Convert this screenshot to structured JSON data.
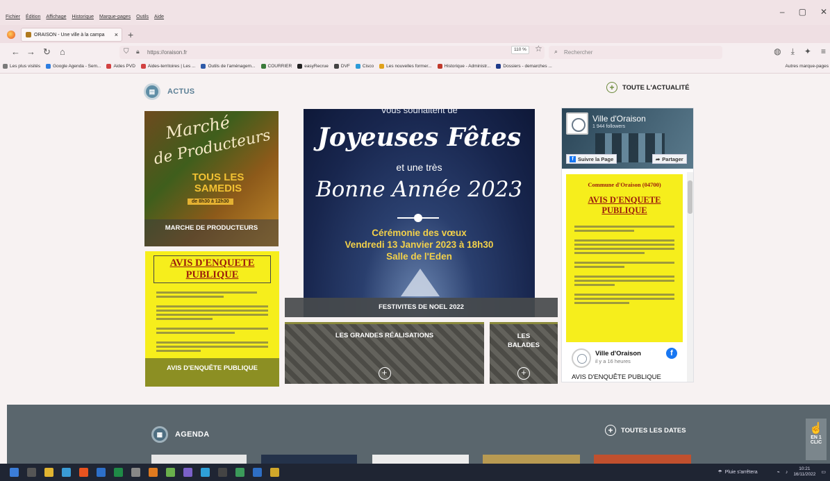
{
  "browser": {
    "menus": [
      "Fichier",
      "Édition",
      "Affichage",
      "Historique",
      "Marque-pages",
      "Outils",
      "Aide"
    ],
    "tab_title": "ORAISON - Une ville à la campa",
    "tab_close": "×",
    "new_tab": "+",
    "url": "https://oraison.fr",
    "zoom": "110 %",
    "search_placeholder": "Rechercher",
    "bookmarks": [
      {
        "label": "Les plus visités",
        "color": "#7a7a7a"
      },
      {
        "label": "Google Agenda - Sem...",
        "color": "#2d7de0"
      },
      {
        "label": "Aides PVD",
        "color": "#d24141"
      },
      {
        "label": "Aides-territoires | Les ...",
        "color": "#d24141"
      },
      {
        "label": "Outils de l'aménagem...",
        "color": "#2e5aa8"
      },
      {
        "label": "COURRIER",
        "color": "#3b7a3a"
      },
      {
        "label": "easyRecrue",
        "color": "#222"
      },
      {
        "label": "DVF",
        "color": "#444"
      },
      {
        "label": "Cisco",
        "color": "#2d9bd8"
      },
      {
        "label": "Les nouvelles former...",
        "color": "#e0a21b"
      },
      {
        "label": "Historique - Administr...",
        "color": "#c0392b"
      },
      {
        "label": "Dossiers - demarches ...",
        "color": "#1e3a8a"
      }
    ],
    "bookmarks_other": "Autres marque-pages"
  },
  "page": {
    "actus": {
      "title": "ACTUS",
      "more": "TOUTE L'ACTUALITÉ"
    },
    "cards": {
      "marche": {
        "script1": "Marché",
        "script2": "de Producteurs",
        "tous": "TOUS LES SAMEDIS",
        "horaire": "de 8h30 à 12h30",
        "caption": "MARCHE DE PRODUCTEURS"
      },
      "avis": {
        "heading": "AVIS D'ENQUETE PUBLIQUE",
        "caption": "AVIS D'ENQUÊTE PUBLIQUE"
      },
      "fetes": {
        "top": "Vous souhaitent de",
        "joyeuses": "Joyeuses Fêtes",
        "et_une_tres": "et une très",
        "bonne_annee": "Bonne Année 2023",
        "ceremonie": "Cérémonie des vœux",
        "date": "Vendredi 13 Janvier 2023 à 18h30",
        "lieu": "Salle de l'Eden",
        "caption": "FESTIVITES DE NOEL 2022"
      },
      "realisations": {
        "label": "LES GRANDES RÉALISATIONS"
      },
      "balades": {
        "label": "LES BALADES"
      }
    },
    "facebook": {
      "page_name": "Ville d'Oraison",
      "followers": "1 944 followers",
      "follow_btn": "Suivre la Page",
      "share_btn": "Partager",
      "post_commune": "Commune d'Oraison (04700)",
      "post_title": "AVIS D'ENQUETE PUBLIQUE",
      "author": "Ville d'Oraison",
      "when": "il y a 16 heures",
      "post_text": "AVIS D'ENQUÊTE PUBLIQUE"
    },
    "agenda": {
      "title": "AGENDA",
      "more": "TOUTES LES DATES",
      "en_clic": "EN 1 CLIC"
    }
  },
  "taskbar": {
    "weather": "Pluie s'arrêtera",
    "time": "10:21",
    "date": "16/11/2022"
  }
}
